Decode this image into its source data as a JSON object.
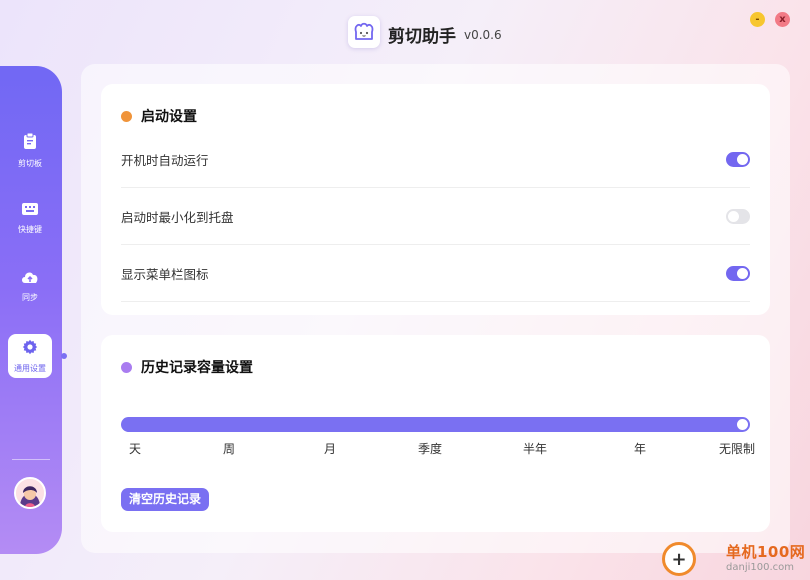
{
  "app": {
    "name": "剪切助手",
    "version": "v0.0.6"
  },
  "window": {
    "minimize_label": "-",
    "close_label": "x"
  },
  "sidebar": {
    "items": [
      {
        "label": "剪切板",
        "icon": "clipboard-icon"
      },
      {
        "label": "快捷键",
        "icon": "keyboard-icon"
      },
      {
        "label": "同步",
        "icon": "cloud-upload-icon"
      },
      {
        "label": "通用设置",
        "icon": "gear-icon",
        "active": true
      }
    ]
  },
  "startup": {
    "title": "启动设置",
    "rows": [
      {
        "label": "开机时自动运行",
        "enabled": true
      },
      {
        "label": "启动时最小化到托盘",
        "enabled": false
      },
      {
        "label": "显示菜单栏图标",
        "enabled": true
      }
    ]
  },
  "history": {
    "title": "历史记录容量设置",
    "ticks": [
      "天",
      "周",
      "月",
      "季度",
      "半年",
      "年",
      "无限制"
    ],
    "selected": "无限制",
    "clear_label": "清空历史记录"
  },
  "watermark": {
    "site": "单机100网",
    "url": "danji100.com"
  },
  "colors": {
    "accent": "#7367f0",
    "startup_dot": "#f0943a",
    "history_dot": "#a97cf0",
    "minimize": "#f7c62f",
    "close": "#f27a86"
  }
}
